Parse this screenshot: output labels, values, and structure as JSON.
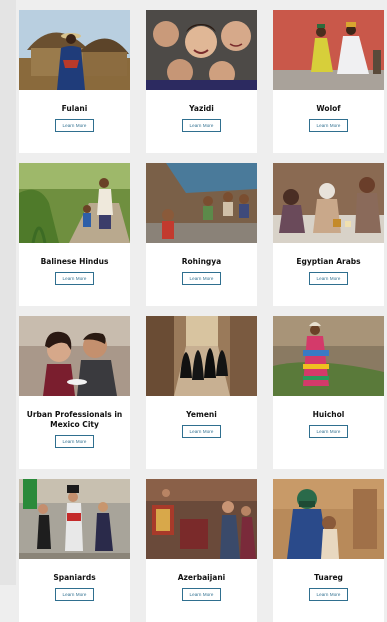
{
  "cards": [
    {
      "title": "Fulani",
      "button": "Learn More",
      "image": "man-in-front-of-thatched-hut"
    },
    {
      "title": "Yazidi",
      "button": "Learn More",
      "image": "group-of-smiling-children"
    },
    {
      "title": "Wolof",
      "button": "Learn More",
      "image": "two-men-sitting-by-red-wall"
    },
    {
      "title": "Balinese Hindus",
      "button": "Learn More",
      "image": "man-and-child-on-garden-path"
    },
    {
      "title": "Rohingya",
      "button": "Learn More",
      "image": "children-under-tarp-shelter"
    },
    {
      "title": "Egyptian Arabs",
      "button": "Learn More",
      "image": "family-sharing-tea-at-table"
    },
    {
      "title": "Urban Professionals in Mexico City",
      "button": "Learn More",
      "image": "couple-laughing-over-coffee"
    },
    {
      "title": "Yemeni",
      "button": "Learn More",
      "image": "women-in-black-walking-narrow-street"
    },
    {
      "title": "Huichol",
      "button": "Learn More",
      "image": "woman-in-colorful-dress-on-hillside"
    },
    {
      "title": "Spaniards",
      "button": "Learn More",
      "image": "folk-dancers-in-costume"
    },
    {
      "title": "Azerbaijani",
      "button": "Learn More",
      "image": "people-in-market-with-rugs"
    },
    {
      "title": "Tuareg",
      "button": "Learn More",
      "image": "man-in-turban-holding-child"
    }
  ]
}
